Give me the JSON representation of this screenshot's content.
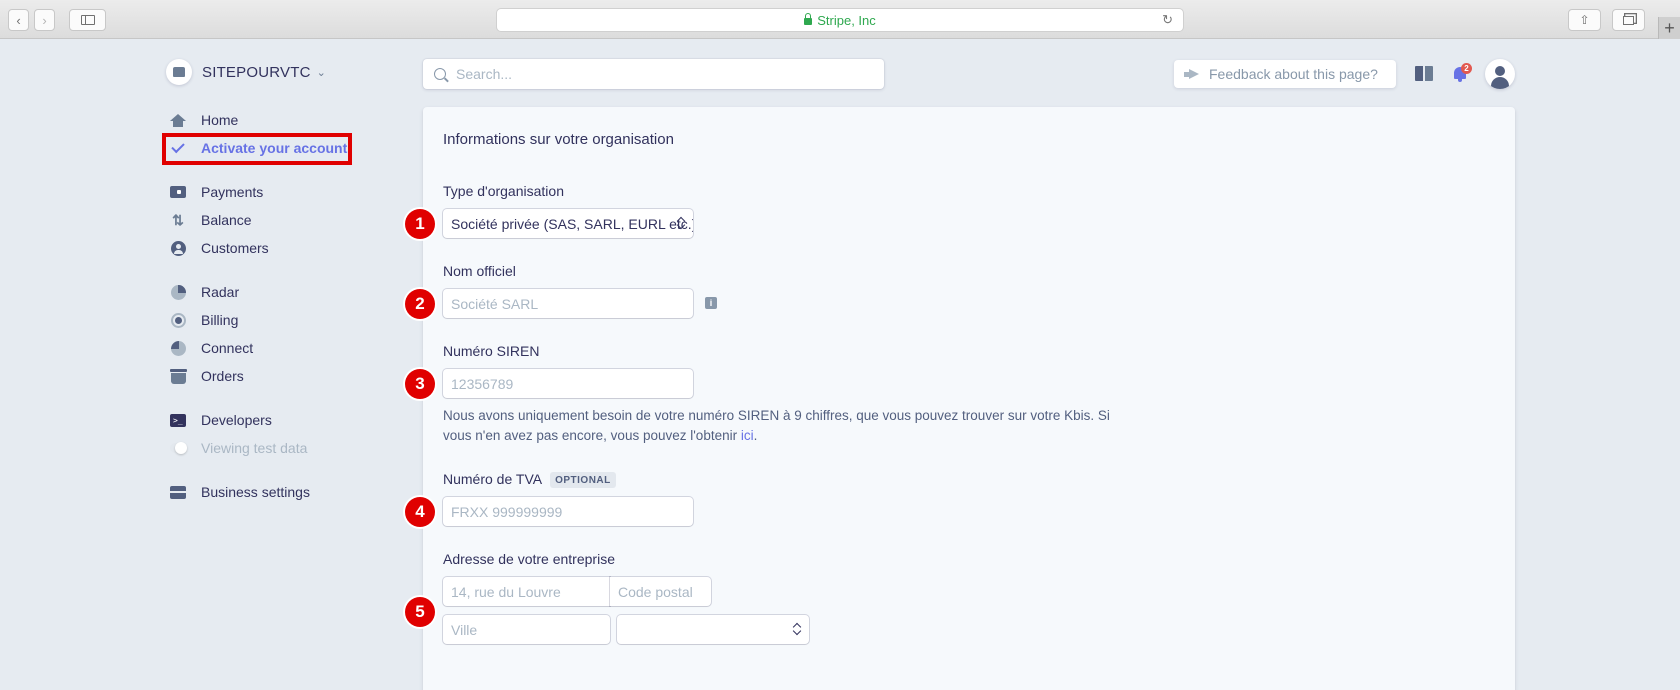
{
  "browser": {
    "url_label": "Stripe, Inc"
  },
  "account": {
    "name": "SITEPOURVTC"
  },
  "search": {
    "placeholder": "Search..."
  },
  "header": {
    "feedback_label": "Feedback about this page?",
    "notification_count": "2"
  },
  "sidebar": {
    "items": [
      {
        "label": "Home",
        "icon": "home-icon"
      },
      {
        "label": "Activate your account",
        "icon": "check-icon"
      },
      {
        "label": "Payments",
        "icon": "payments-icon"
      },
      {
        "label": "Balance",
        "icon": "balance-icon"
      },
      {
        "label": "Customers",
        "icon": "customers-icon"
      },
      {
        "label": "Radar",
        "icon": "radar-icon"
      },
      {
        "label": "Billing",
        "icon": "billing-icon"
      },
      {
        "label": "Connect",
        "icon": "connect-icon"
      },
      {
        "label": "Orders",
        "icon": "orders-icon"
      },
      {
        "label": "Developers",
        "icon": "developers-icon"
      },
      {
        "label": "Viewing test data",
        "icon": "toggle-icon"
      },
      {
        "label": "Business settings",
        "icon": "business-settings-icon"
      }
    ]
  },
  "form": {
    "title": "Informations sur votre organisation",
    "org_type": {
      "label": "Type d'organisation",
      "value": "Société privée (SAS, SARL, EURL etc.)"
    },
    "legal_name": {
      "label": "Nom officiel",
      "placeholder": "Société SARL"
    },
    "siren": {
      "label": "Numéro SIREN",
      "placeholder": "12356789",
      "help_text": "Nous avons uniquement besoin de votre numéro SIREN à 9 chiffres, que vous pouvez trouver sur votre Kbis. Si vous n'en avez pas encore, vous pouvez l'obtenir ",
      "help_link": "ici",
      "help_end": "."
    },
    "vat": {
      "label": "Numéro de TVA",
      "optional_badge": "OPTIONAL",
      "placeholder": "FRXX 999999999"
    },
    "address": {
      "label": "Adresse de votre entreprise",
      "street_placeholder": "14, rue du Louvre",
      "postal_placeholder": "Code postal",
      "city_placeholder": "Ville",
      "country_value": ""
    }
  },
  "annotations": [
    "1",
    "2",
    "3",
    "4",
    "5"
  ],
  "colors": {
    "accent": "#6772e5",
    "annotation_red": "#e00000",
    "secure_green": "#2fa84f"
  }
}
